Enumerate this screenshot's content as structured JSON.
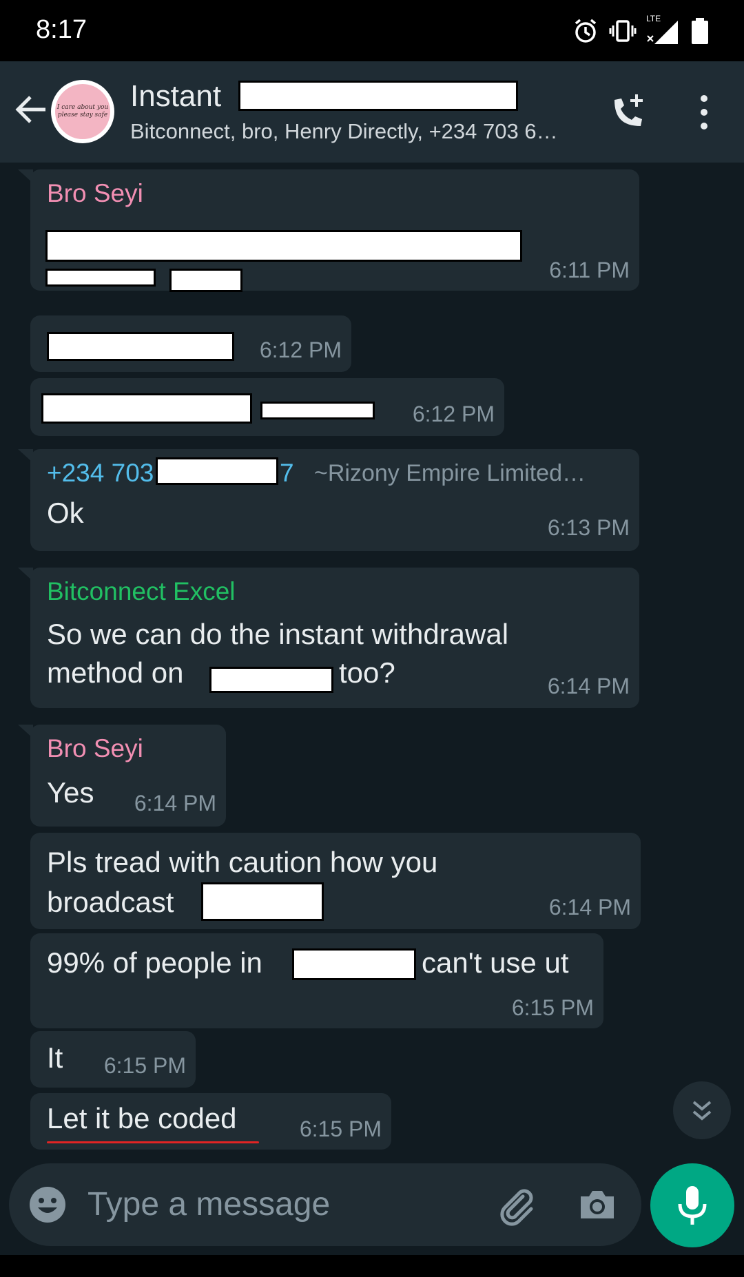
{
  "status_bar": {
    "time": "8:17",
    "icons": [
      "alarm-icon",
      "vibrate-icon",
      "lte-signal-icon",
      "battery-icon"
    ],
    "lte_label": "LTE"
  },
  "header": {
    "title": "Instant",
    "participants": "Bitconnect, bro, Henry Directly, +234 703 6…",
    "avatar_text": "I care about you please stay safe"
  },
  "messages": [
    {
      "sender": "Bro Seyi",
      "time": "6:11 PM"
    },
    {
      "time": "6:12 PM"
    },
    {
      "time": "6:12 PM"
    },
    {
      "sender_prefix": "+234 703",
      "sender_suffix": "7",
      "push_name": "~Rizony Empire Limited…",
      "text": "Ok",
      "time": "6:13 PM"
    },
    {
      "sender": "Bitconnect Excel",
      "text_line1": "So we can do the instant withdrawal",
      "text_line2_a": "method on",
      "text_line2_b": "too?",
      "time": "6:14 PM"
    },
    {
      "sender": "Bro Seyi",
      "text": "Yes",
      "time": "6:14 PM"
    },
    {
      "text_line1": "Pls tread with caution how you",
      "text_line2": "broadcast",
      "time": "6:14 PM"
    },
    {
      "text_a": "99% of people in",
      "text_b": "can't use ut",
      "time": "6:15 PM"
    },
    {
      "text": "It",
      "time": "6:15 PM"
    },
    {
      "text": "Let it be coded",
      "time": "6:15 PM"
    }
  ],
  "composer": {
    "placeholder": "Type a message"
  },
  "colors": {
    "background": "#111b21",
    "bubble": "#202c33",
    "header": "#1f2c34",
    "sender_pink": "#f28fb3",
    "sender_teal": "#53bdeb",
    "sender_green": "#21c063",
    "accent": "#00a884",
    "timestamp": "#8696a0"
  }
}
